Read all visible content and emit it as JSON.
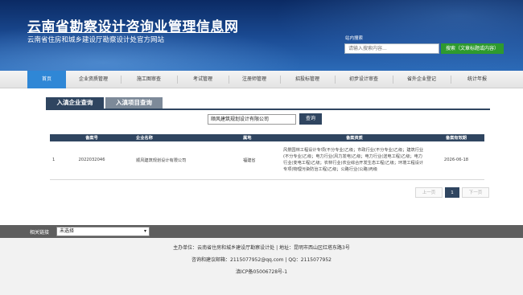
{
  "header": {
    "title": "云南省勘察设计咨询业管理信息网",
    "subtitle": "云南省住房和城乡建设厅勘察设计处官方网站",
    "search_label": "站内搜索",
    "search_placeholder": "请输入搜索内容...",
    "search_button": "搜索（文章标题或内容）"
  },
  "nav": {
    "items": [
      "首页",
      "企业资质管理",
      "施工图审查",
      "考试管理",
      "注册师管理",
      "招投标管理",
      "初步设计审查",
      "省外企业登记",
      "统计年报"
    ],
    "active_index": 0
  },
  "tabs": {
    "active": "入滇企业查询",
    "inactive": "入滇项目查询"
  },
  "query": {
    "value": "顺风建筑规划设计有限公司",
    "button": "查询"
  },
  "table": {
    "headers": [
      "",
      "备案号",
      "企业名称",
      "属地",
      "备案资质",
      "备案有效期"
    ],
    "rows": [
      {
        "index": "1",
        "record_no": "2022032046",
        "company": "顺风建筑规划设计有限公司",
        "region": "福建省",
        "qualification": "风景园林工程设计专项(不分专业)乙级；市政行业(不分专业)乙级；建筑行业(不分专业)乙级；电力行业(风力发电)乙级；电力行业(送电工程)乙级；电力行业(变电工程)乙级；农林行业(农业综合开发生态工程)乙级；环境工程设计专项(物理污染防治工程)乙级；公路行业(公路)丙级",
        "valid_until": "2026-06-18"
      }
    ]
  },
  "pagination": {
    "prev": "上一页",
    "current": "1",
    "next": "下一页"
  },
  "footer": {
    "related_label": "相关链接",
    "related_select": "未选择",
    "host": "主办单位：云南省住房和城乡建设厅勘察设计处 | 地址：昆明市西山区红塔东路3号",
    "contact": "咨询和建议邮箱：2115077952@qq.com | QQ：2115077952",
    "icp": "滇ICP备05006728号-1"
  },
  "colors": {
    "header_dark": "#0b2a63",
    "nav_active": "#2f87d6",
    "tab_dark": "#2f4560",
    "search_green": "#2e9a2e",
    "footer_bar": "#5e5e5e"
  }
}
